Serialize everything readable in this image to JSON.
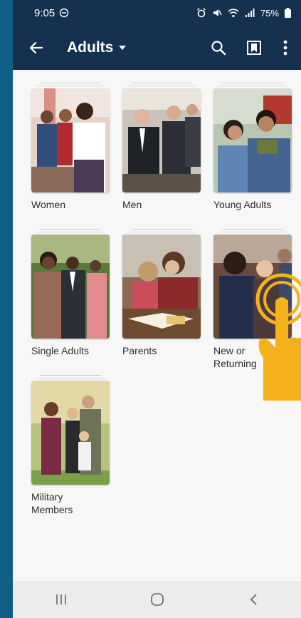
{
  "status": {
    "time": "9:05",
    "battery": "75%"
  },
  "appbar": {
    "title": "Adults"
  },
  "categories": [
    {
      "label": "Women"
    },
    {
      "label": "Men"
    },
    {
      "label": "Young Adults"
    },
    {
      "label": "Single Adults"
    },
    {
      "label": "Parents"
    },
    {
      "label": "New or Returning"
    },
    {
      "label": "Military Members"
    }
  ],
  "icons": {
    "back": "arrow-left-icon",
    "dropdown": "caret-down-icon",
    "search": "search-icon",
    "bookmarks": "bookmark-icon",
    "more": "more-vert-icon",
    "recents": "recents-icon",
    "home": "home-icon",
    "nav_back": "nav-back-icon"
  },
  "colors": {
    "appbar": "#15314f",
    "background": "#0f5f86",
    "hand": "#f5b119"
  }
}
